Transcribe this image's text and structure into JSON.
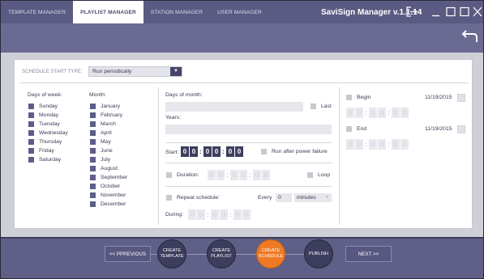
{
  "header": {
    "tabs": [
      {
        "label": "TEMPLATE MANAGER"
      },
      {
        "label": "PLAYLIST MANAGER"
      },
      {
        "label": "STATION MANAGER"
      },
      {
        "label": "USER MANAGER"
      }
    ],
    "active_tab": "PLAYLIST MANAGER",
    "app_title": "SaviSign Manager v.1.1.14",
    "window_controls": [
      "exit-icon",
      "minimize-icon",
      "maximize-icon",
      "close-icon"
    ],
    "back_icon": "back-arrow-icon"
  },
  "schedule": {
    "start_type_label": "SCHEDULE START TYPE:",
    "start_type_value": "Run periodically",
    "days_of_week": {
      "label": "Days of week:",
      "items": [
        "Sunday",
        "Monday",
        "Tuesday",
        "Wednesday",
        "Thursday",
        "Friday",
        "Saturday"
      ]
    },
    "month": {
      "label": "Month:",
      "items": [
        "January",
        "February",
        "March",
        "April",
        "May",
        "June",
        "July",
        "August",
        "September",
        "October",
        "November",
        "December"
      ]
    },
    "days_of_month_label": "Days of month:",
    "last_label": "Last",
    "years_label": "Years:",
    "start": {
      "label": "Start:",
      "h": "00",
      "m": "00",
      "s": "00"
    },
    "run_after_power_failure_label": "Run after power failure",
    "duration": {
      "label": "Duration:",
      "h": "00",
      "m": "00",
      "s": "00"
    },
    "loop_label": "Loop",
    "repeat_label": "Repeat schedule:",
    "every_label": "Every",
    "every_value": "0",
    "every_unit": "minutes",
    "during": {
      "label": "During:",
      "h": "00",
      "m": "00",
      "s": "00"
    },
    "begin": {
      "label": "Begin",
      "date": "11/19/2015",
      "h": "00",
      "m": "00",
      "s": "00"
    },
    "end": {
      "label": "End",
      "date": "11/19/2015",
      "h": "00",
      "m": "00",
      "s": "00"
    }
  },
  "wizard": {
    "prev_label": "<< PPREVIOUS",
    "next_label": "NEXT >>",
    "steps": [
      {
        "line1": "CREATE",
        "line2": "TEMPLATE"
      },
      {
        "line1": "CREATE",
        "line2": "PLAYLIST"
      },
      {
        "line1": "CREATE",
        "line2": "SCHEDULE"
      },
      {
        "line1": "PUBLISH",
        "line2": ""
      }
    ],
    "active_step": "CREATE SCHEDULE"
  },
  "colors": {
    "header_bg": "#5a5a82",
    "accent_orange": "#ef7a26",
    "checkbox": "#5d5d8a",
    "step_dark": "#3d3d5d"
  }
}
